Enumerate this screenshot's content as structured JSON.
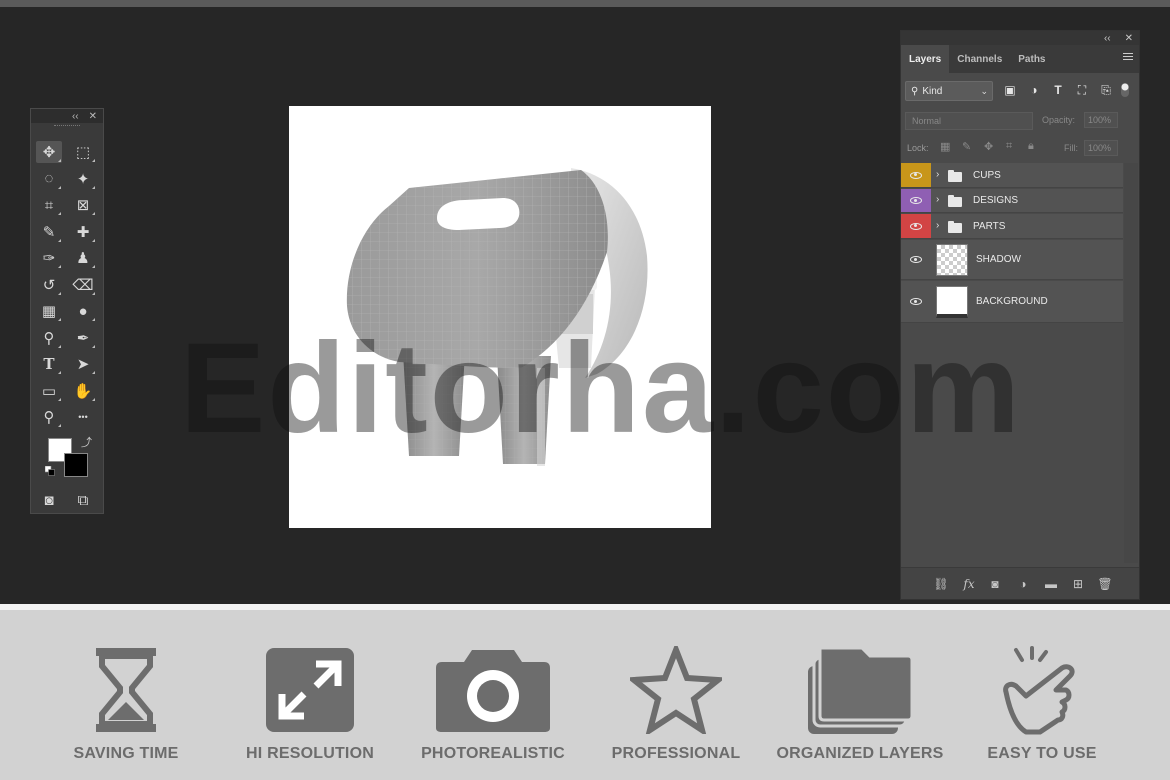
{
  "toolbox": {
    "collapse_icon": "double-chevron-left-icon",
    "close_icon": "close-icon",
    "tools": [
      {
        "name": "move-tool",
        "glyph": "✥"
      },
      {
        "name": "marquee-tool",
        "glyph": "⬚"
      },
      {
        "name": "lasso-tool",
        "glyph": "◌"
      },
      {
        "name": "magic-wand-tool",
        "glyph": "✦"
      },
      {
        "name": "crop-tool",
        "glyph": "⌗"
      },
      {
        "name": "frame-tool",
        "glyph": "⊠"
      },
      {
        "name": "eyedropper-tool",
        "glyph": "✎"
      },
      {
        "name": "healing-brush-tool",
        "glyph": "✚"
      },
      {
        "name": "brush-tool",
        "glyph": "✑"
      },
      {
        "name": "stamp-tool",
        "glyph": "♟"
      },
      {
        "name": "history-brush-tool",
        "glyph": "↺"
      },
      {
        "name": "eraser-tool",
        "glyph": "⌫"
      },
      {
        "name": "gradient-tool",
        "glyph": "▦"
      },
      {
        "name": "blur-tool",
        "glyph": "●"
      },
      {
        "name": "dodge-tool",
        "glyph": "⚲"
      },
      {
        "name": "pen-tool",
        "glyph": "✒"
      },
      {
        "name": "type-tool",
        "glyph": "T"
      },
      {
        "name": "path-selection-tool",
        "glyph": "➤"
      },
      {
        "name": "rectangle-tool",
        "glyph": "▭"
      },
      {
        "name": "hand-tool",
        "glyph": "✋"
      },
      {
        "name": "zoom-tool",
        "glyph": "⚲"
      },
      {
        "name": "more-tools",
        "glyph": "•••"
      },
      {
        "name": "quick-mask-tool",
        "glyph": "◙"
      },
      {
        "name": "screen-mode-tool",
        "glyph": "⧉"
      }
    ],
    "foreground_color": "#ffffff",
    "background_color": "#000000"
  },
  "watermark": "Editorha.com",
  "layers_panel": {
    "tabs": [
      "Layers",
      "Channels",
      "Paths"
    ],
    "active_tab": "Layers",
    "filter": {
      "label": "Kind"
    },
    "blend_mode": "Normal",
    "opacity_label": "Opacity:",
    "opacity_value": "100%",
    "lock_label": "Lock:",
    "fill_label": "Fill:",
    "fill_value": "100%",
    "layers": [
      {
        "name": "CUPS",
        "type": "group",
        "color": "#c8961a"
      },
      {
        "name": "DESIGNS",
        "type": "group",
        "color": "#8f5fb3"
      },
      {
        "name": "PARTS",
        "type": "group",
        "color": "#d24444"
      },
      {
        "name": "SHADOW",
        "type": "layer",
        "thumb": "transparent"
      },
      {
        "name": "BACKGROUND",
        "type": "layer",
        "thumb": "white"
      }
    ],
    "footer_icons": [
      "link-icon",
      "fx-icon",
      "mask-icon",
      "adjustment-icon",
      "folder-icon",
      "new-layer-icon",
      "trash-icon"
    ]
  },
  "features": [
    {
      "label": "SAVING TIME",
      "icon": "hourglass-icon"
    },
    {
      "label": "HI RESOLUTION",
      "icon": "expand-icon"
    },
    {
      "label": "PHOTOREALISTIC",
      "icon": "camera-icon"
    },
    {
      "label": "PROFESSIONAL",
      "icon": "star-icon"
    },
    {
      "label": "ORGANIZED LAYERS",
      "icon": "layers-folder-icon"
    },
    {
      "label": "EASY TO USE",
      "icon": "hand-pointer-icon"
    }
  ],
  "colors": {
    "workspace": "#262626",
    "panel": "#4a4a4a",
    "feature_icon": "#6d6d6d",
    "feature_strip": "#d2d2d2"
  }
}
